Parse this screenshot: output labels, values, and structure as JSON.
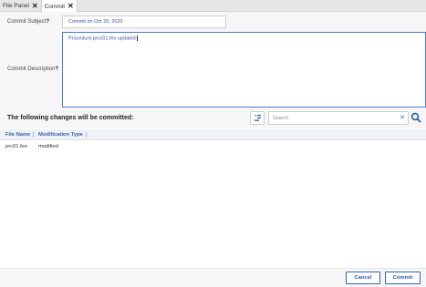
{
  "tabs": [
    {
      "label": "File Panel",
      "active": false
    },
    {
      "label": "Commit",
      "active": true
    }
  ],
  "form": {
    "subject_label": "Commit Subject",
    "subject_value": "Commit on Oct 20, 2020",
    "description_label": "Commit Description",
    "description_value": "Procedure prcc01.fex updated",
    "required_mark": "?"
  },
  "changes": {
    "title": "The following changes will be committed:",
    "search_placeholder": "Search",
    "clear_icon": "close-icon",
    "columns": [
      "File Name",
      "Modification Type"
    ],
    "rows": [
      {
        "file_name": "prc01.fex",
        "modification_type": "modified"
      }
    ]
  },
  "footer": {
    "cancel_label": "Cancel",
    "commit_label": "Commit"
  },
  "colors": {
    "accent": "#2a5aa8",
    "focus_border": "#4a7fc8",
    "header_bg": "#eef2f7"
  }
}
